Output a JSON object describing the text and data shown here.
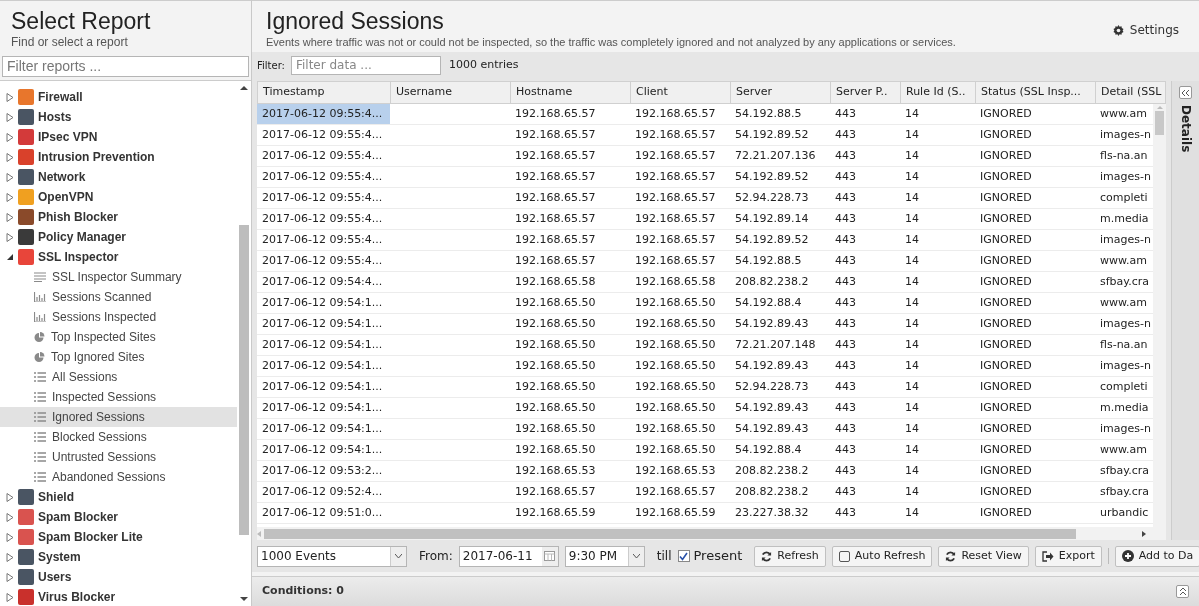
{
  "sidebar": {
    "title": "Select Report",
    "subtitle": "Find or select a report",
    "filter": {
      "placeholder": "Filter reports ..."
    },
    "items": [
      {
        "label": "Firewall",
        "color": "#e8762c",
        "expanded": false
      },
      {
        "label": "Hosts",
        "color": "#4a5563",
        "expanded": false
      },
      {
        "label": "IPsec VPN",
        "color": "#d33a3a",
        "expanded": false
      },
      {
        "label": "Intrusion Prevention",
        "color": "#d9412b",
        "expanded": false
      },
      {
        "label": "Network",
        "color": "#4a5563",
        "expanded": false
      },
      {
        "label": "OpenVPN",
        "color": "#f0a020",
        "expanded": false
      },
      {
        "label": "Phish Blocker",
        "color": "#8a4a2a",
        "expanded": false
      },
      {
        "label": "Policy Manager",
        "color": "#3a3a3a",
        "expanded": false
      },
      {
        "label": "SSL Inspector",
        "color": "#e8453a",
        "expanded": true,
        "children": [
          {
            "label": "SSL Inspector Summary",
            "kind": "summary",
            "selected": false
          },
          {
            "label": "Sessions Scanned",
            "kind": "bars",
            "selected": false
          },
          {
            "label": "Sessions Inspected",
            "kind": "bars",
            "selected": false
          },
          {
            "label": "Top Inspected Sites",
            "kind": "pie",
            "selected": false
          },
          {
            "label": "Top Ignored Sites",
            "kind": "pie",
            "selected": false
          },
          {
            "label": "All Sessions",
            "kind": "list",
            "selected": false
          },
          {
            "label": "Inspected Sessions",
            "kind": "list",
            "selected": false
          },
          {
            "label": "Ignored Sessions",
            "kind": "list",
            "selected": true
          },
          {
            "label": "Blocked Sessions",
            "kind": "list",
            "selected": false
          },
          {
            "label": "Untrusted Sessions",
            "kind": "list",
            "selected": false
          },
          {
            "label": "Abandoned Sessions",
            "kind": "list",
            "selected": false
          }
        ]
      },
      {
        "label": "Shield",
        "color": "#4a5563",
        "expanded": false
      },
      {
        "label": "Spam Blocker",
        "color": "#d9534f",
        "expanded": false
      },
      {
        "label": "Spam Blocker Lite",
        "color": "#d9534f",
        "expanded": false
      },
      {
        "label": "System",
        "color": "#4a5563",
        "expanded": false
      },
      {
        "label": "Users",
        "color": "#4a5563",
        "expanded": false
      },
      {
        "label": "Virus Blocker",
        "color": "#c9302c",
        "expanded": false
      }
    ]
  },
  "report": {
    "title": "Ignored Sessions",
    "description": "Events where traffic was not or could not be inspected, so the traffic was completely ignored and not analyzed by any applications or services.",
    "settings": "Settings",
    "filter_label": "Filter:",
    "filter": {
      "placeholder": "Filter data ..."
    },
    "entries": "1000 entries"
  },
  "table": {
    "columns": [
      "Timestamp",
      "Username",
      "Hostname",
      "Client",
      "Server",
      "Server P..",
      "Rule Id (S..",
      "Status (SSL Insp...",
      "Detail (SSL"
    ],
    "rows": [
      {
        "selected": true,
        "cells": [
          "2017-06-12 09:55:4...",
          "",
          "192.168.65.57",
          "192.168.65.57",
          "54.192.88.5",
          "443",
          "14",
          "IGNORED",
          "www.am"
        ]
      },
      {
        "selected": false,
        "cells": [
          "2017-06-12 09:55:4...",
          "",
          "192.168.65.57",
          "192.168.65.57",
          "54.192.89.52",
          "443",
          "14",
          "IGNORED",
          "images-n"
        ]
      },
      {
        "selected": false,
        "cells": [
          "2017-06-12 09:55:4...",
          "",
          "192.168.65.57",
          "192.168.65.57",
          "72.21.207.136",
          "443",
          "14",
          "IGNORED",
          "fls-na.an"
        ]
      },
      {
        "selected": false,
        "cells": [
          "2017-06-12 09:55:4...",
          "",
          "192.168.65.57",
          "192.168.65.57",
          "54.192.89.52",
          "443",
          "14",
          "IGNORED",
          "images-n"
        ]
      },
      {
        "selected": false,
        "cells": [
          "2017-06-12 09:55:4...",
          "",
          "192.168.65.57",
          "192.168.65.57",
          "52.94.228.73",
          "443",
          "14",
          "IGNORED",
          "completi"
        ]
      },
      {
        "selected": false,
        "cells": [
          "2017-06-12 09:55:4...",
          "",
          "192.168.65.57",
          "192.168.65.57",
          "54.192.89.14",
          "443",
          "14",
          "IGNORED",
          "m.media"
        ]
      },
      {
        "selected": false,
        "cells": [
          "2017-06-12 09:55:4...",
          "",
          "192.168.65.57",
          "192.168.65.57",
          "54.192.89.52",
          "443",
          "14",
          "IGNORED",
          "images-n"
        ]
      },
      {
        "selected": false,
        "cells": [
          "2017-06-12 09:55:4...",
          "",
          "192.168.65.57",
          "192.168.65.57",
          "54.192.88.5",
          "443",
          "14",
          "IGNORED",
          "www.am"
        ]
      },
      {
        "selected": false,
        "cells": [
          "2017-06-12 09:54:4...",
          "",
          "192.168.65.58",
          "192.168.65.58",
          "208.82.238.2",
          "443",
          "14",
          "IGNORED",
          "sfbay.cra"
        ]
      },
      {
        "selected": false,
        "cells": [
          "2017-06-12 09:54:1...",
          "",
          "192.168.65.50",
          "192.168.65.50",
          "54.192.88.4",
          "443",
          "14",
          "IGNORED",
          "www.am"
        ]
      },
      {
        "selected": false,
        "cells": [
          "2017-06-12 09:54:1...",
          "",
          "192.168.65.50",
          "192.168.65.50",
          "54.192.89.43",
          "443",
          "14",
          "IGNORED",
          "images-n"
        ]
      },
      {
        "selected": false,
        "cells": [
          "2017-06-12 09:54:1...",
          "",
          "192.168.65.50",
          "192.168.65.50",
          "72.21.207.148",
          "443",
          "14",
          "IGNORED",
          "fls-na.an"
        ]
      },
      {
        "selected": false,
        "cells": [
          "2017-06-12 09:54:1...",
          "",
          "192.168.65.50",
          "192.168.65.50",
          "54.192.89.43",
          "443",
          "14",
          "IGNORED",
          "images-n"
        ]
      },
      {
        "selected": false,
        "cells": [
          "2017-06-12 09:54:1...",
          "",
          "192.168.65.50",
          "192.168.65.50",
          "52.94.228.73",
          "443",
          "14",
          "IGNORED",
          "completi"
        ]
      },
      {
        "selected": false,
        "cells": [
          "2017-06-12 09:54:1...",
          "",
          "192.168.65.50",
          "192.168.65.50",
          "54.192.89.43",
          "443",
          "14",
          "IGNORED",
          "m.media"
        ]
      },
      {
        "selected": false,
        "cells": [
          "2017-06-12 09:54:1...",
          "",
          "192.168.65.50",
          "192.168.65.50",
          "54.192.89.43",
          "443",
          "14",
          "IGNORED",
          "images-n"
        ]
      },
      {
        "selected": false,
        "cells": [
          "2017-06-12 09:54:1...",
          "",
          "192.168.65.50",
          "192.168.65.50",
          "54.192.88.4",
          "443",
          "14",
          "IGNORED",
          "www.am"
        ]
      },
      {
        "selected": false,
        "cells": [
          "2017-06-12 09:53:2...",
          "",
          "192.168.65.53",
          "192.168.65.53",
          "208.82.238.2",
          "443",
          "14",
          "IGNORED",
          "sfbay.cra"
        ]
      },
      {
        "selected": false,
        "cells": [
          "2017-06-12 09:52:4...",
          "",
          "192.168.65.57",
          "192.168.65.57",
          "208.82.238.2",
          "443",
          "14",
          "IGNORED",
          "sfbay.cra"
        ]
      },
      {
        "selected": false,
        "cells": [
          "2017-06-12 09:51:0...",
          "",
          "192.168.65.59",
          "192.168.65.59",
          "23.227.38.32",
          "443",
          "14",
          "IGNORED",
          "urbandic"
        ]
      }
    ]
  },
  "details_panel": {
    "label": "Details"
  },
  "toolbar": {
    "limit": "1000 Events",
    "from_label": "From:",
    "date": "2017-06-11",
    "time": "9:30 PM",
    "till_label": "till",
    "present": {
      "label": "Present",
      "checked": true
    },
    "buttons": [
      {
        "label": "Refresh",
        "kind": "refresh"
      },
      {
        "label": "Auto Refresh",
        "kind": "checkbox",
        "checked": false
      },
      {
        "label": "Reset View",
        "kind": "refresh"
      },
      {
        "label": "Export",
        "kind": "export"
      },
      {
        "label": "Add to Da",
        "kind": "add"
      }
    ]
  },
  "conditions": "Conditions: 0"
}
